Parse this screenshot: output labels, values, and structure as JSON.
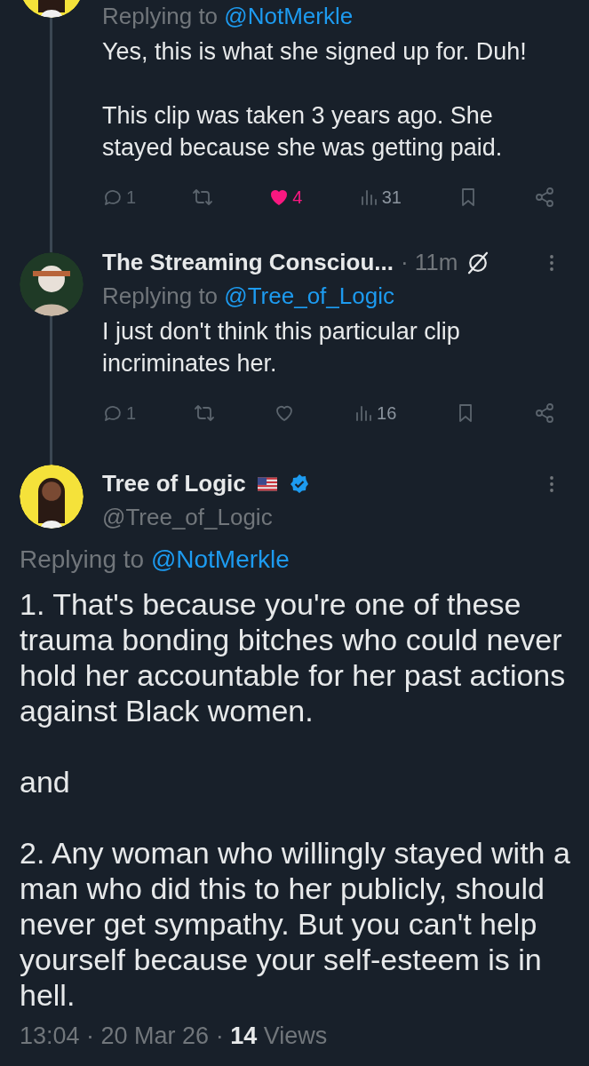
{
  "replies": [
    {
      "partial": true,
      "replying_label": "Replying to",
      "replying_handle": "@NotMerkle",
      "paragraphs": [
        "Yes, this is what she signed up for. Duh!",
        "This clip was taken 3 years ago. She stayed because she was getting paid."
      ],
      "actions": [
        {
          "kind": "reply",
          "count": "1"
        },
        {
          "kind": "retweet"
        },
        {
          "kind": "like",
          "count": "4",
          "liked": true
        },
        {
          "kind": "views",
          "count": "31"
        },
        {
          "kind": "bookmark"
        },
        {
          "kind": "share"
        }
      ]
    },
    {
      "partial": false,
      "name": "The Streaming Consciou...",
      "time": "· 11m",
      "replying_label": "Replying to",
      "replying_handle": "@Tree_of_Logic",
      "paragraphs": [
        "I just don't think this particular clip incriminates her."
      ],
      "actions": [
        {
          "kind": "reply",
          "count": "1"
        },
        {
          "kind": "retweet"
        },
        {
          "kind": "like",
          "liked": false
        },
        {
          "kind": "views",
          "count": "16"
        },
        {
          "kind": "bookmark"
        },
        {
          "kind": "share"
        }
      ]
    }
  ],
  "main_tweet": {
    "name": "Tree of Logic",
    "verified": true,
    "handle": "@Tree_of_Logic",
    "replying_label": "Replying to",
    "replying_handle": "@NotMerkle",
    "paragraphs": [
      "1. That's because you're one of these trauma bonding bitches who could never hold her accountable for her past actions against Black women.",
      "and",
      "2. Any woman who willingly stayed with a man who did this to her publicly, should never get sympathy. But you can't help yourself because your self-esteem is in hell."
    ],
    "meta": "13:04 · 20 Mar 26 · **14** Views"
  }
}
